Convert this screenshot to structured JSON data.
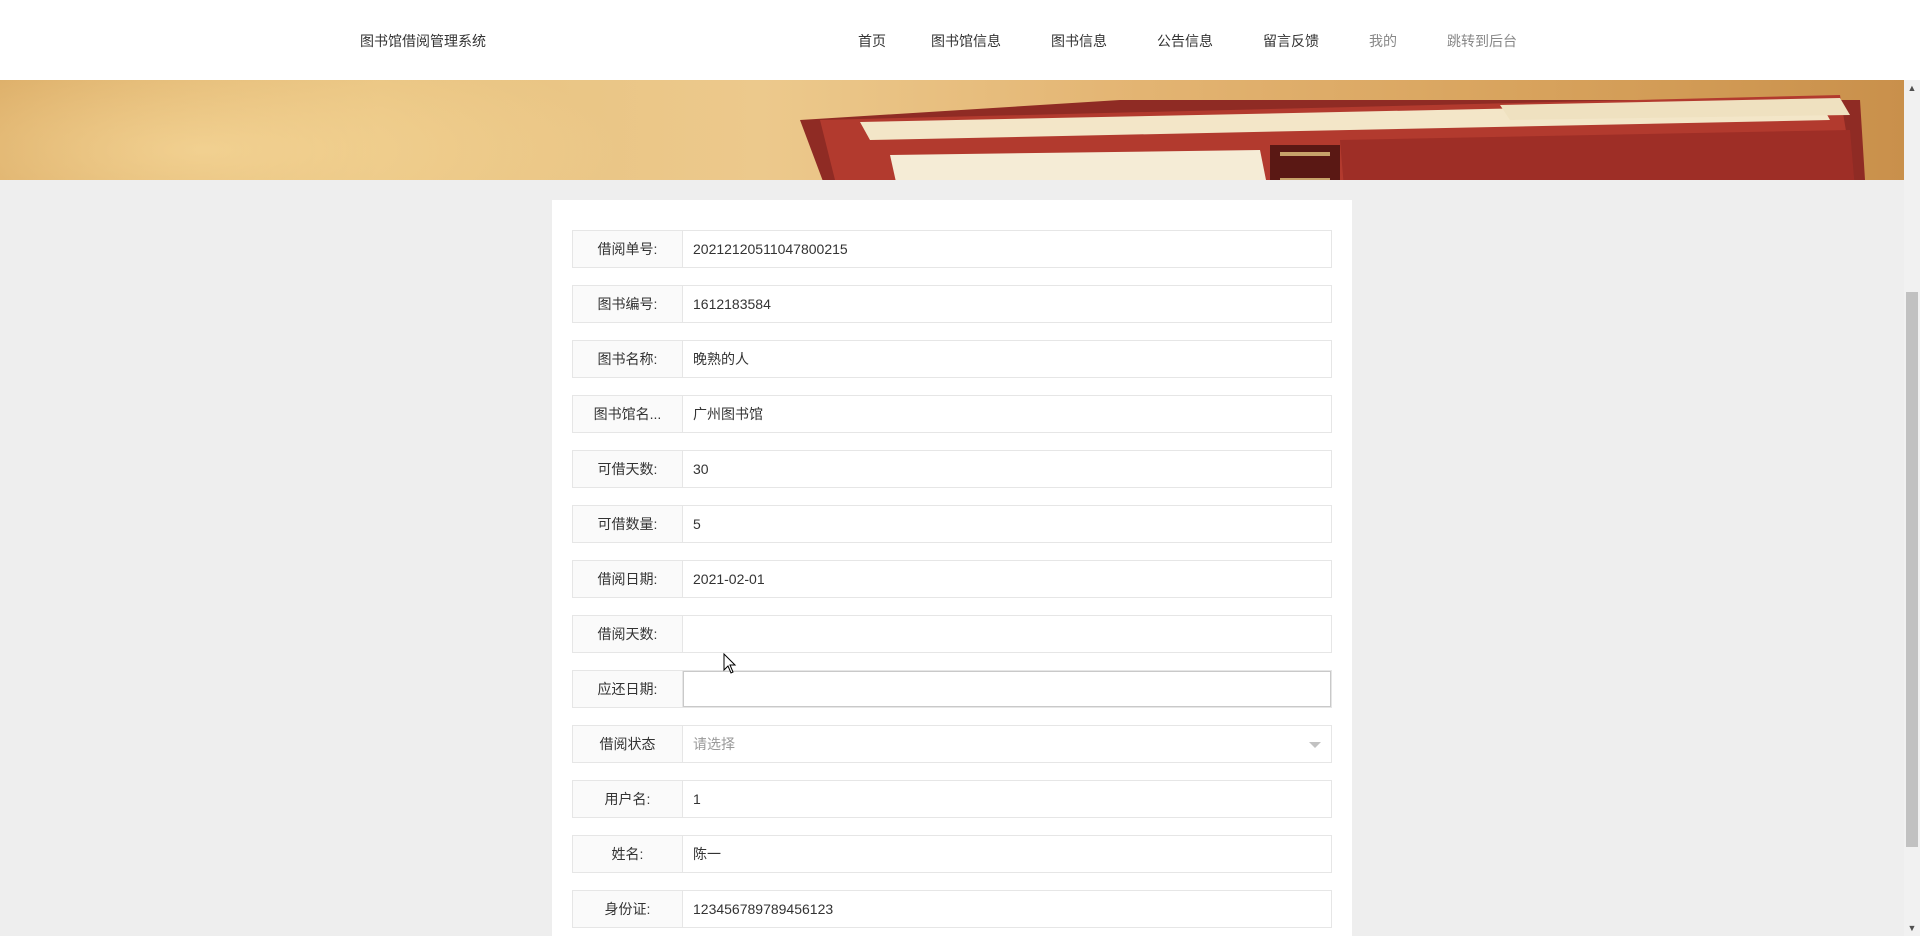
{
  "header": {
    "brand": "图书馆借阅管理系统",
    "nav": [
      {
        "label": "首页"
      },
      {
        "label": "图书馆信息"
      },
      {
        "label": "图书信息"
      },
      {
        "label": "公告信息"
      },
      {
        "label": "留言反馈"
      },
      {
        "label": "我的"
      },
      {
        "label": "跳转到后台"
      }
    ]
  },
  "form": {
    "fields": [
      {
        "label": "借阅单号:",
        "value": "20212120511047800215"
      },
      {
        "label": "图书编号:",
        "value": "1612183584"
      },
      {
        "label": "图书名称:",
        "value": "晚熟的人"
      },
      {
        "label": "图书馆名...",
        "value": "广州图书馆"
      },
      {
        "label": "可借天数:",
        "value": "30"
      },
      {
        "label": "可借数量:",
        "value": "5"
      },
      {
        "label": "借阅日期:",
        "value": "2021-02-01"
      },
      {
        "label": "借阅天数:",
        "value": ""
      },
      {
        "label": "应还日期:",
        "value": ""
      },
      {
        "label": "借阅状态",
        "value": "请选择"
      },
      {
        "label": "用户名:",
        "value": "1"
      },
      {
        "label": "姓名:",
        "value": "陈一"
      },
      {
        "label": "身份证:",
        "value": "123456789789456123"
      }
    ]
  },
  "colors": {
    "page_bg": "#eeeeee",
    "card_bg": "#ffffff",
    "label_bg": "#fafafa",
    "border": "#e6e6e6"
  }
}
